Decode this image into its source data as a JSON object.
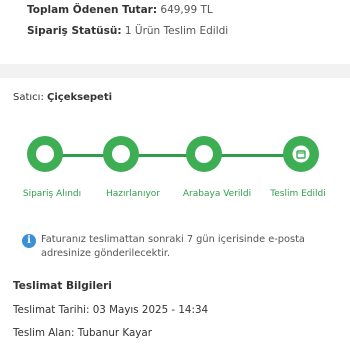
{
  "payment": {
    "total_label": "Toplam Ödenen Tutar:",
    "total_value": "649,99 TL",
    "status_label": "Sipariş Statüsü:",
    "status_value": "1 Ürün Teslim Edildi"
  },
  "seller": {
    "label": "Satıcı:",
    "name": "Çiçeksepeti"
  },
  "tracking": {
    "accent_color": "#3dae54",
    "steps": [
      {
        "label": "Sipariş Alındı",
        "icon": "circle-icon"
      },
      {
        "label": "Hazırlanıyor",
        "icon": "circle-icon"
      },
      {
        "label": "Arabaya Verildi",
        "icon": "circle-icon"
      },
      {
        "label": "Teslim Edildi",
        "icon": "package-icon"
      }
    ]
  },
  "notice": {
    "icon": "info-icon",
    "text": "Faturanız teslimattan sonraki 7 gün içerisinde e-posta adresinize gönderilecektir."
  },
  "delivery": {
    "title": "Teslimat Bilgileri",
    "date_label": "Teslimat Tarihi:",
    "date_value": "03 Mayıs 2025 - 14:34",
    "receiver_label": "Teslim Alan:",
    "receiver_value": "Tubanur Kayar"
  }
}
